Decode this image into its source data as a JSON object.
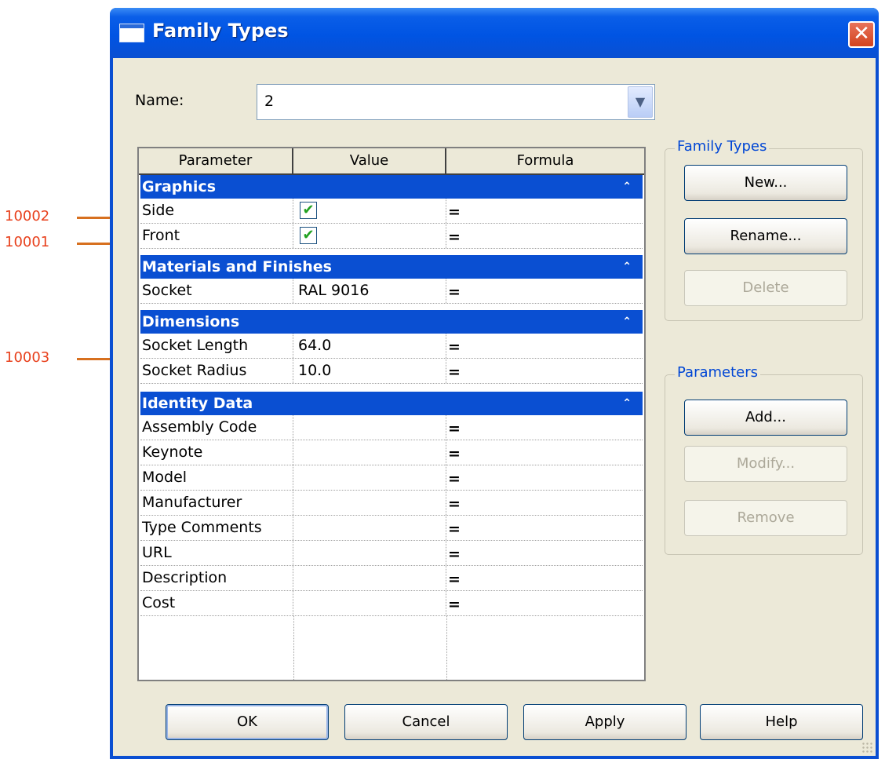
{
  "callouts": [
    {
      "label": "10002"
    },
    {
      "label": "10001"
    },
    {
      "label": "10003"
    }
  ],
  "window": {
    "title": "Family Types",
    "close_glyph": "✕"
  },
  "name_field": {
    "label": "Name:",
    "value": "2"
  },
  "grid": {
    "columns": [
      "Parameter",
      "Value",
      "Formula"
    ],
    "groups": {
      "graphics": "Graphics",
      "materials": "Materials and Finishes",
      "dimensions": "Dimensions",
      "identity": "Identity Data"
    },
    "rows": {
      "side": {
        "param": "Side",
        "checked": true,
        "formula": "="
      },
      "front": {
        "param": "Front",
        "checked": true,
        "formula": "="
      },
      "socket": {
        "param": "Socket",
        "value": "RAL 9016",
        "formula": "="
      },
      "socket_length": {
        "param": "Socket Length",
        "value": "64.0",
        "formula": "="
      },
      "socket_radius": {
        "param": "Socket Radius",
        "value": "10.0",
        "formula": "="
      },
      "assembly_code": {
        "param": "Assembly Code",
        "value": "",
        "formula": "="
      },
      "keynote": {
        "param": "Keynote",
        "value": "",
        "formula": "="
      },
      "model": {
        "param": "Model",
        "value": "",
        "formula": "="
      },
      "manufacturer": {
        "param": "Manufacturer",
        "value": "",
        "formula": "="
      },
      "type_comments": {
        "param": "Type Comments",
        "value": "",
        "formula": "="
      },
      "url": {
        "param": "URL",
        "value": "",
        "formula": "="
      },
      "description": {
        "param": "Description",
        "value": "",
        "formula": "="
      },
      "cost": {
        "param": "Cost",
        "value": "",
        "formula": "="
      }
    },
    "collapse_glyph": "⌃"
  },
  "family_types_box": {
    "legend": "Family Types",
    "new": "New...",
    "rename": "Rename...",
    "delete": "Delete"
  },
  "parameters_box": {
    "legend": "Parameters",
    "add": "Add...",
    "modify": "Modify...",
    "remove": "Remove"
  },
  "footer": {
    "ok": "OK",
    "cancel": "Cancel",
    "apply": "Apply",
    "help": "Help"
  },
  "colors": {
    "titlebar": "#0054e3",
    "group_header": "#0a4fd2",
    "callout_text": "#e8401c",
    "callout_line": "#d7701f",
    "legend_text": "#0046d5"
  }
}
